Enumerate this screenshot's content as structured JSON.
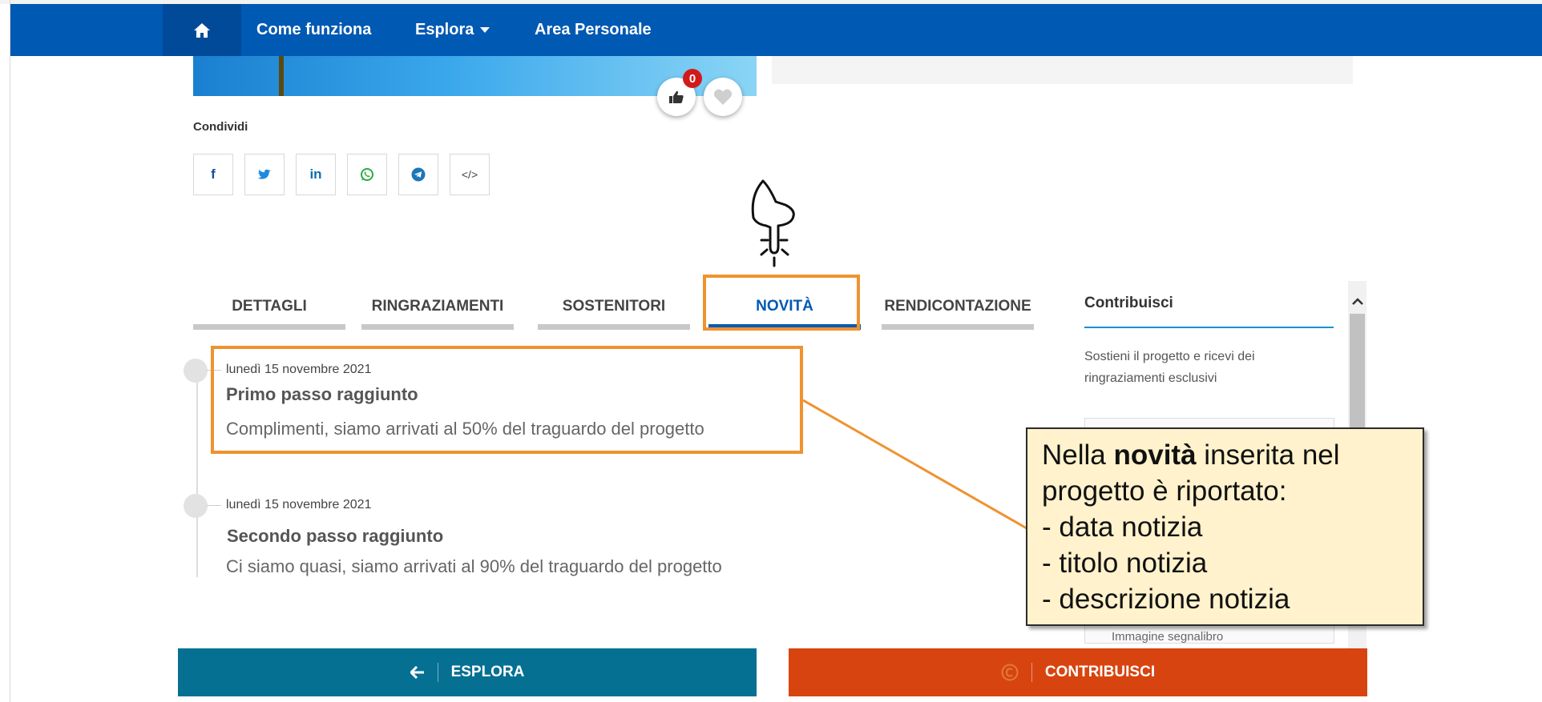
{
  "nav": {
    "home_icon": "home-icon",
    "items": [
      {
        "label": "Come funziona"
      },
      {
        "label": "Esplora"
      },
      {
        "label": "Area Personale"
      }
    ]
  },
  "project": {
    "likes_count": "0",
    "like_icon": "thumbs-up-icon",
    "favorite_icon": "heart-icon"
  },
  "share": {
    "label": "Condividi",
    "buttons": [
      {
        "icon": "facebook-icon",
        "glyph": "f"
      },
      {
        "icon": "twitter-icon",
        "glyph": ""
      },
      {
        "icon": "linkedin-icon",
        "glyph": "in"
      },
      {
        "icon": "whatsapp-icon",
        "glyph": ""
      },
      {
        "icon": "telegram-icon",
        "glyph": ""
      },
      {
        "icon": "embed-code-icon",
        "glyph": "</>"
      }
    ]
  },
  "tabs": [
    {
      "label": "DETTAGLI",
      "active": false
    },
    {
      "label": "RINGRAZIAMENTI",
      "active": false
    },
    {
      "label": "SOSTENITORI",
      "active": false
    },
    {
      "label": "NOVITÀ",
      "active": true
    },
    {
      "label": "RENDICONTAZIONE",
      "active": false
    }
  ],
  "news": [
    {
      "date": "lunedì 15 novembre 2021",
      "title": "Primo passo raggiunto",
      "description": "Complimenti, siamo arrivati al 50% del traguardo del progetto"
    },
    {
      "date": "lunedì 15 novembre 2021",
      "title": "Secondo passo raggiunto",
      "description": "Ci siamo quasi, siamo arrivati al 90% del traguardo del progetto"
    }
  ],
  "sidebar": {
    "title": "Contribuisci",
    "text": "Sostieni il progetto e ricevi dei ringraziamenti esclusivi",
    "cut_text": "Immagine segnalibro"
  },
  "callout": {
    "line1_pre": "Nella ",
    "line1_bold": "novità",
    "line1_post": " inserita nel",
    "line2": "progetto è riportato:",
    "line3": "- data notizia",
    "line4": "- titolo notizia",
    "line5": "- descrizione notizia"
  },
  "buttons": {
    "explore": "ESPLORA",
    "contribute": "CONTRIBUISCI"
  },
  "colors": {
    "nav_bg": "#0059b3",
    "highlight": "#f0922e",
    "explore_btn": "#067093",
    "contribute_btn": "#d8440f",
    "callout_bg": "#fff2cc"
  }
}
